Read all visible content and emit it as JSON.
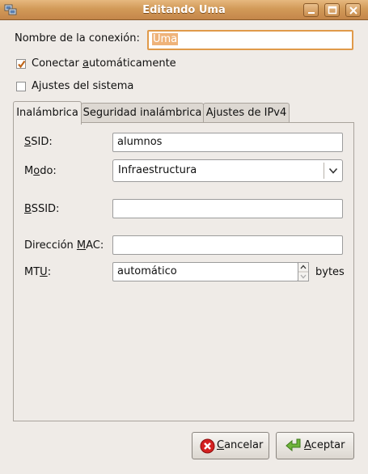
{
  "window": {
    "title": "Editando Uma",
    "controls": [
      "minimize",
      "maximize",
      "close"
    ]
  },
  "connection": {
    "name_label_pre": "Nombre de la conexión:",
    "name_value": "Uma",
    "auto_connect": {
      "label_pre": "Conectar ",
      "label_mnemonic": "a",
      "label_post": "utomáticamente",
      "checked": true
    },
    "system_settings": {
      "label": "Ajustes del sistema",
      "checked": false
    }
  },
  "tabs": [
    {
      "label": "Inalámbrica",
      "active": true
    },
    {
      "label": "Seguridad inalámbrica",
      "active": false
    },
    {
      "label": "Ajustes de IPv4",
      "active": false
    }
  ],
  "wireless": {
    "ssid": {
      "mnemonic": "S",
      "rest": "SID:",
      "value": "alumnos"
    },
    "mode": {
      "pre": "M",
      "mnemonic": "o",
      "rest": "do:",
      "value": "Infraestructura"
    },
    "bssid": {
      "mnemonic": "B",
      "rest": "SSID:",
      "value": ""
    },
    "mac": {
      "pre": "Dirección ",
      "mnemonic": "M",
      "rest": "AC:",
      "value": ""
    },
    "mtu": {
      "pre": "MT",
      "mnemonic": "U",
      "rest": ":",
      "value": "automático",
      "unit": "bytes"
    }
  },
  "buttons": {
    "cancel": {
      "mnemonic": "C",
      "rest": "ancelar"
    },
    "accept": {
      "mnemonic": "A",
      "rest": "ceptar"
    }
  },
  "colors": {
    "titlebar": "#d29a58",
    "focus": "#e09a4a",
    "check": "#c0661a"
  },
  "icons": {
    "app": "network-connection-icon",
    "cancel": "cancel-icon",
    "accept": "apply-icon"
  }
}
